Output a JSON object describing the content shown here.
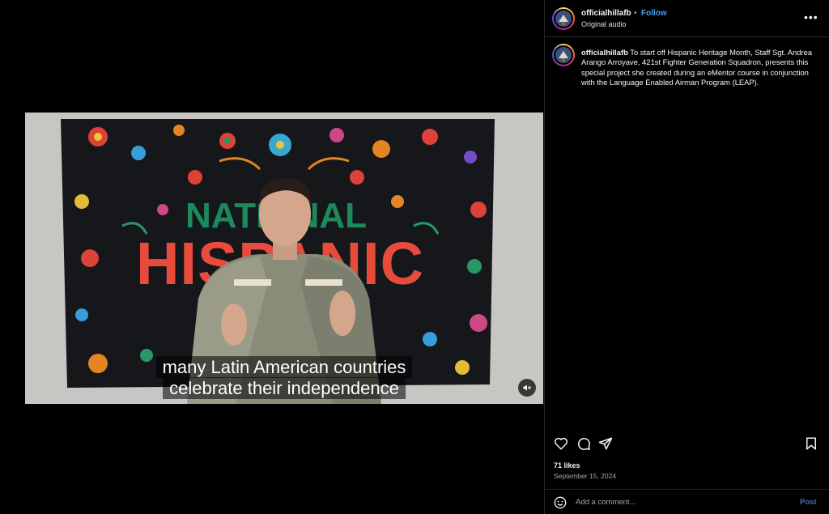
{
  "post": {
    "username": "officialhillafb",
    "separator": "•",
    "follow_label": "Follow",
    "audio_label": "Original audio",
    "more_icon": "more-horizontal-icon",
    "caption_text": "To start off Hispanic Heritage Month, Staff Sgt. Andrea Arango Arroyave, 421st Fighter Generation Squadron, presents this special project she created during an eMentor course in conjunction with the Language Enabled Airman Program (LEAP).",
    "likes": "71 likes",
    "date": "September 15, 2024"
  },
  "video": {
    "banner_line1": "NATIONAL",
    "banner_line2": "HISPANIC",
    "subtitle_line1": "many Latin American countries",
    "subtitle_line2": "celebrate their independence",
    "mute_icon": "muted-speaker-icon"
  },
  "actions": {
    "like_icon": "heart-icon",
    "comment_icon": "comment-bubble-icon",
    "share_icon": "paper-plane-icon",
    "save_icon": "bookmark-icon"
  },
  "comment_bar": {
    "placeholder": "Add a comment...",
    "post_label": "Post",
    "emoji_icon": "emoji-smile-icon"
  },
  "colors": {
    "follow_blue": "#4a9ff5",
    "post_disabled": "#4b6e9e",
    "banner_green": "#1d8a5b",
    "background": "#000000"
  }
}
